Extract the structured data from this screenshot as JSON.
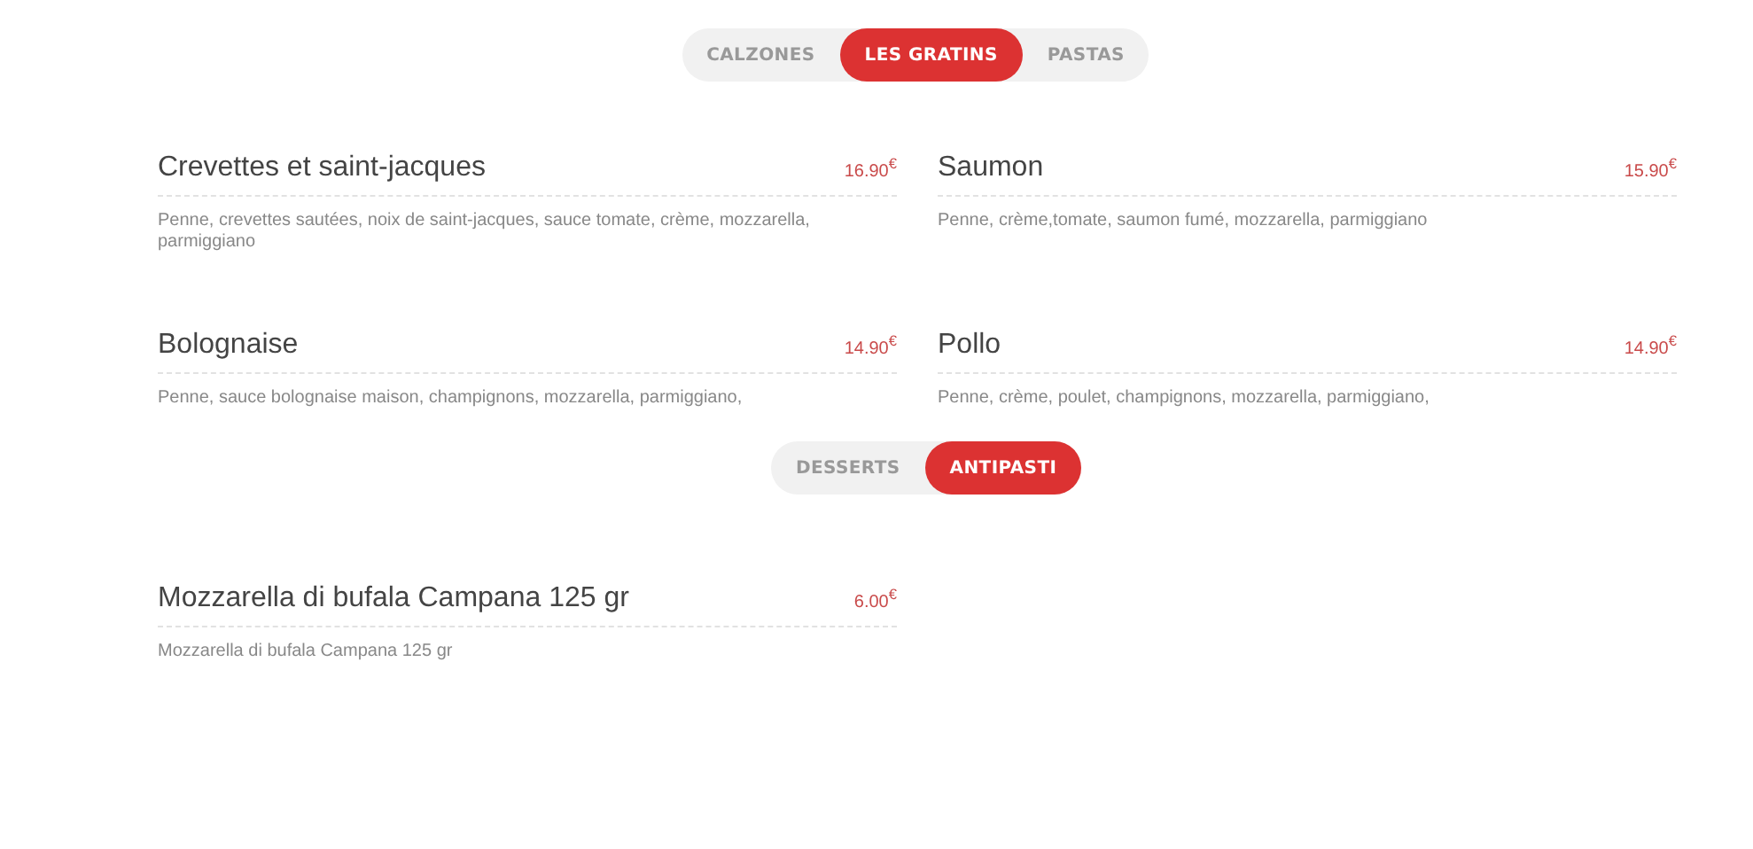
{
  "sections": [
    {
      "tabs": [
        {
          "label": "CALZONES",
          "selected": false
        },
        {
          "label": "LES GRATINS",
          "selected": true
        },
        {
          "label": "PASTAS",
          "selected": false
        }
      ],
      "items": [
        {
          "name": "Crevettes et saint-jacques",
          "price": "16.90$^{€}$",
          "description": "Penne, crevettes sautées, noix de saint-jacques, sauce tomate, crème, mozzarella, parmiggiano"
        },
        {
          "name": "Saumon",
          "price": "15.90$^{€}$",
          "description": "Penne, crème,tomate, saumon fumé, mozzarella, parmiggiano"
        },
        {
          "name": "Bolognaise",
          "price": "14.90$^{€}$",
          "description": "Penne, sauce bolognaise maison, champignons, mozzarella, parmiggiano,"
        },
        {
          "name": "Pollo",
          "price": "14.90$^{€}$",
          "description": "Penne, crème, poulet, champignons, mozzarella, parmiggiano,"
        }
      ]
    },
    {
      "tabs": [
        {
          "label": "DESSERTS",
          "selected": false
        },
        {
          "label": "ANTIPASTI",
          "selected": true
        }
      ],
      "items": [
        {
          "name": "Mozzarella di bufala Campana 125 gr",
          "price": "6.00$^{€}$",
          "description": "Mozzarella di bufala Campana 125 gr"
        }
      ]
    }
  ]
}
